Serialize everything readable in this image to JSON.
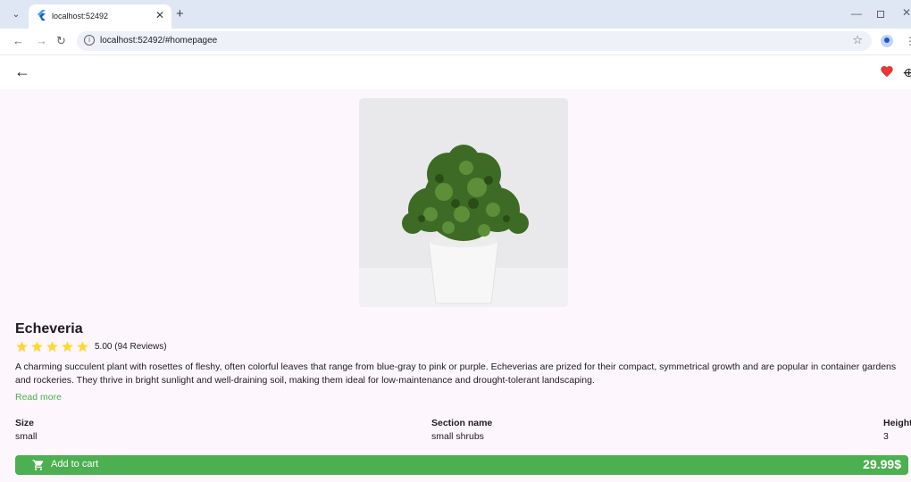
{
  "browser": {
    "tab_title": "localhost:52492",
    "url": "localhost:52492/#homepagee",
    "icons": [
      "tab-list-icon",
      "flutter-favicon",
      "close-icon",
      "plus-icon",
      "back-arrow-icon",
      "forward-arrow-icon",
      "reload-icon",
      "info-icon",
      "star-icon",
      "profile-icon",
      "menu-icon",
      "minimize-icon",
      "restore-icon",
      "close-window-icon"
    ]
  },
  "appbar": {
    "icons": [
      "back-arrow-icon",
      "heart-icon",
      "share-icon"
    ],
    "favorite_color": "#e53935"
  },
  "product": {
    "name": "Echeveria",
    "rating": 5.0,
    "rating_text": "5.00 (94 Reviews)",
    "star_color": "#fdd835",
    "description": "A charming succulent plant with rosettes of fleshy, often colorful leaves that range from blue-gray to pink or purple. Echeverias are prized for their compact, symmetrical growth and are popular in container gardens and rockeries. They thrive in bright sunlight and well-draining soil, making them ideal for low-maintenance and drought-tolerant landscaping.",
    "read_more": "Read more",
    "specs": [
      {
        "label": "Size",
        "value": "small"
      },
      {
        "label": "Section name",
        "value": "small shrubs"
      },
      {
        "label": "Height",
        "value": "3"
      }
    ]
  },
  "cart": {
    "label": "Add to cart",
    "price": "29.99$",
    "accent": "#4caf50"
  }
}
